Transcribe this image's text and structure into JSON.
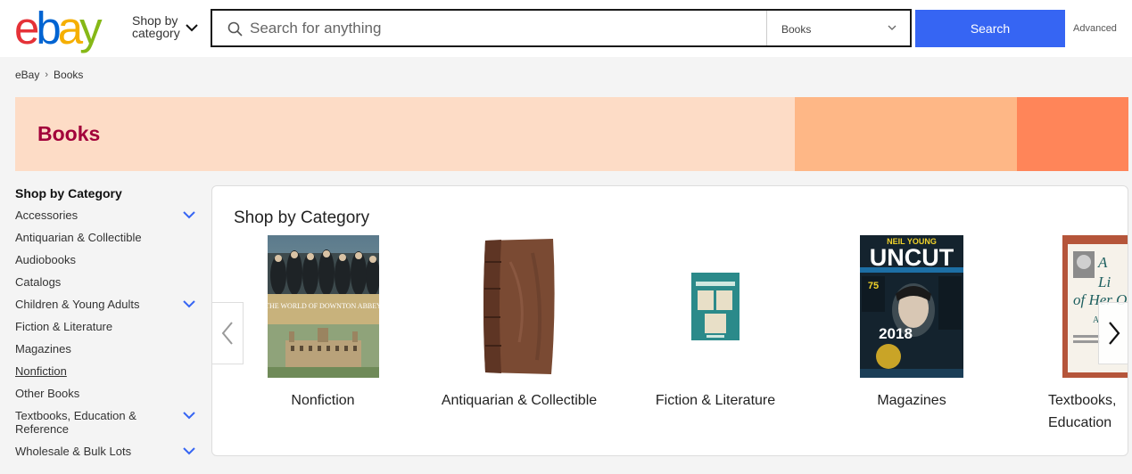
{
  "header": {
    "logo_letters": [
      "e",
      "b",
      "a",
      "y"
    ],
    "logo_colors": [
      "#e53238",
      "#0064d2",
      "#f5af02",
      "#86b817"
    ],
    "shop_by_line1": "Shop by",
    "shop_by_line2": "category",
    "search_placeholder": "Search for anything",
    "category_select": "Books",
    "search_button": "Search",
    "advanced": "Advanced",
    "accent": "#3665f3"
  },
  "breadcrumb": [
    "eBay",
    "Books"
  ],
  "banner": {
    "title": "Books",
    "colors": [
      "#fddcc6",
      "#feb786",
      "#ff8559"
    ]
  },
  "sidebar": {
    "heading": "Shop by Category",
    "items": [
      {
        "label": "Accessories",
        "expandable": true
      },
      {
        "label": "Antiquarian & Collectible",
        "expandable": false
      },
      {
        "label": "Audiobooks",
        "expandable": false
      },
      {
        "label": "Catalogs",
        "expandable": false
      },
      {
        "label": "Children & Young Adults",
        "expandable": true
      },
      {
        "label": "Fiction & Literature",
        "expandable": false
      },
      {
        "label": "Magazines",
        "expandable": false
      },
      {
        "label": "Nonfiction",
        "expandable": false,
        "selected": true
      },
      {
        "label": "Other Books",
        "expandable": false
      },
      {
        "label": "Textbooks, Education & Reference",
        "expandable": true
      },
      {
        "label": "Wholesale & Bulk Lots",
        "expandable": true
      }
    ]
  },
  "panel": {
    "title": "Shop by Category",
    "cards": [
      {
        "label": "Nonfiction",
        "image": "downton-abbey-book-cover",
        "cover_title": "THE WORLD OF DOWNTON ABBEY"
      },
      {
        "label": "Antiquarian & Collectible",
        "image": "antique-leather-book"
      },
      {
        "label": "Fiction & Literature",
        "image": "small-teal-book"
      },
      {
        "label": "Magazines",
        "image": "uncut-magazine-cover",
        "cover_title": "UNCUT",
        "cover_top": "NEIL YOUNG",
        "cover_year": "2018"
      },
      {
        "label": "Textbooks, Education",
        "image": "textbook-cover",
        "cover_title": "A Life of Her Own"
      }
    ]
  }
}
